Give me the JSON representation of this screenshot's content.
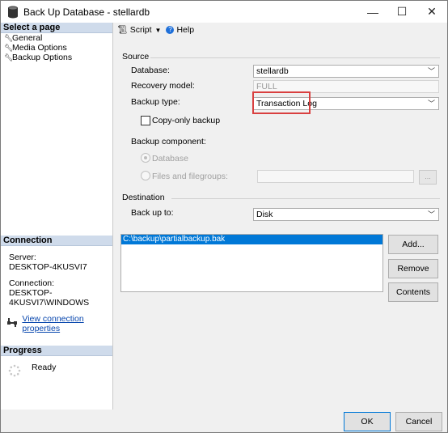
{
  "window": {
    "title": "Back Up Database - stellardb",
    "minimize_glyph": "—",
    "maximize_glyph": "☐",
    "close_glyph": "✕"
  },
  "sidebar": {
    "header": "Select a page",
    "pages": [
      {
        "label": "General",
        "icon": "wrench-icon"
      },
      {
        "label": "Media Options",
        "icon": "wrench-icon"
      },
      {
        "label": "Backup Options",
        "icon": "wrench-icon"
      }
    ],
    "connection": {
      "header": "Connection",
      "server_label": "Server:",
      "server_value": "DESKTOP-4KUSVI7",
      "connection_label": "Connection:",
      "connection_value": "DESKTOP-4KUSVI7\\WINDOWS",
      "view_link": "View connection properties"
    },
    "progress": {
      "header": "Progress",
      "status": "Ready"
    }
  },
  "toolbar": {
    "script_label": "Script",
    "help_label": "Help"
  },
  "source": {
    "group_label": "Source",
    "database_label": "Database:",
    "database_value": "stellardb",
    "recovery_label": "Recovery model:",
    "recovery_value": "FULL",
    "backup_type_label": "Backup type:",
    "backup_type_value": "Transaction Log",
    "copy_only_label": "Copy-only backup",
    "component_label": "Backup component:",
    "radio_database": "Database",
    "radio_files": "Files and filegroups:",
    "browse_label": "..."
  },
  "destination": {
    "group_label": "Destination",
    "backup_to_label": "Back up to:",
    "backup_to_value": "Disk",
    "files": [
      "C:\\backup\\partialbackup.bak"
    ],
    "add_label": "Add...",
    "remove_label": "Remove",
    "contents_label": "Contents"
  },
  "footer": {
    "ok_label": "OK",
    "cancel_label": "Cancel"
  },
  "colors": {
    "highlight": "#d94040",
    "selection": "#0078d7",
    "sidebar_header": "#cfdbeb"
  }
}
